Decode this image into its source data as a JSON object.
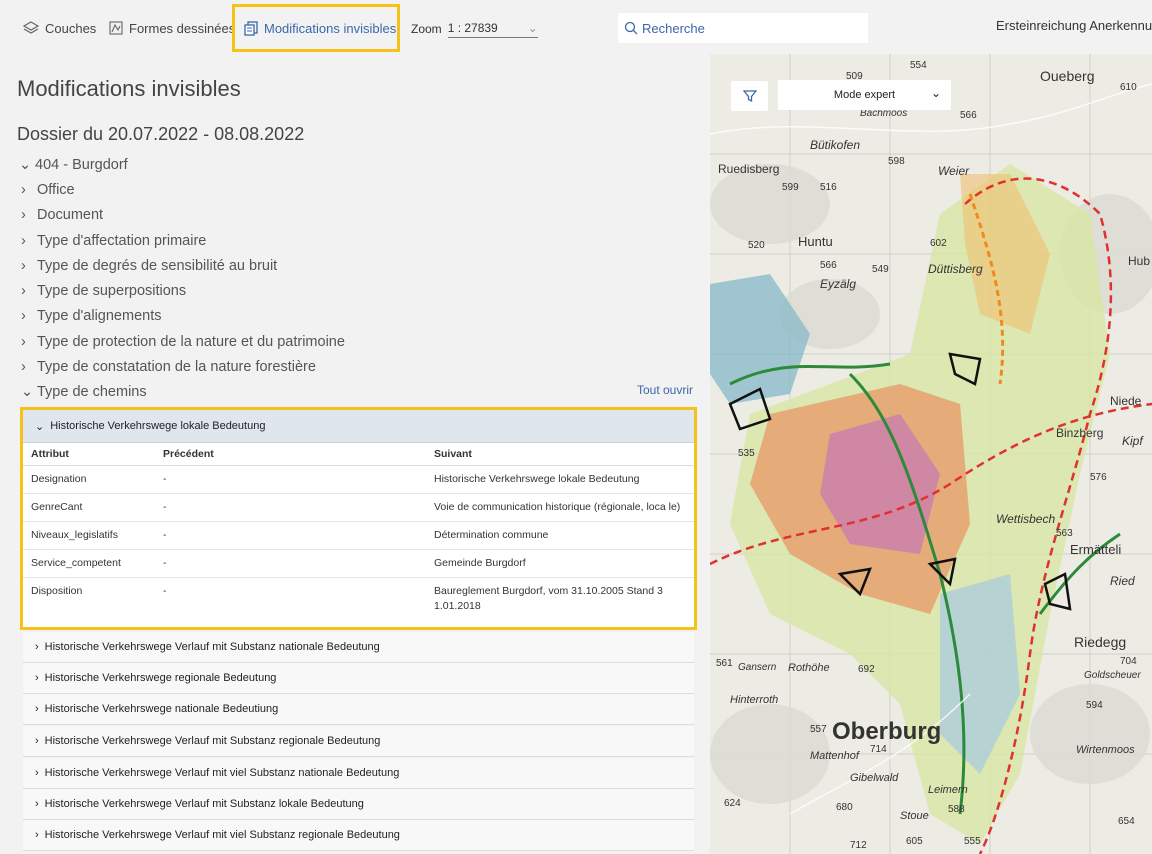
{
  "toolbar": {
    "layers_label": "Couches",
    "shapes_label": "Formes dessinées",
    "invisible_label": "Modifications invisibles",
    "zoom_label": "Zoom",
    "zoom_value": "1 : 27839",
    "search_placeholder": "Recherche",
    "right_text": "Ersteinreichung Anerkennung"
  },
  "panel": {
    "title": "Modifications invisibles",
    "dossier": "Dossier du 20.07.2022 - 08.08.2022",
    "tree": [
      {
        "label": "404 - Burgdorf",
        "chev": "⌄"
      },
      {
        "label": "Office",
        "chev": "›"
      },
      {
        "label": "Document",
        "chev": "›"
      },
      {
        "label": "Type d'affectation primaire",
        "chev": "›"
      },
      {
        "label": "Type de degrés de sensibilité au bruit",
        "chev": "›"
      },
      {
        "label": "Type de superpositions",
        "chev": "›"
      },
      {
        "label": "Type d'alignements",
        "chev": "›"
      },
      {
        "label": "Type de protection de la nature et du patrimoine",
        "chev": "›"
      },
      {
        "label": "Type de constatation de la nature forestière",
        "chev": "›"
      },
      {
        "label": "Type de chemins",
        "chev": "⌄"
      }
    ],
    "open_all": "Tout ouvrir",
    "expanded": {
      "title": "Historische Verkehrswege lokale Bedeutung",
      "headers": [
        "Attribut",
        "Précédent",
        "Suivant"
      ],
      "rows": [
        [
          "Designation",
          "-",
          "Historische Verkehrswege lokale Bedeutung"
        ],
        [
          "GenreCant",
          "-",
          "Voie de communication historique (régionale, loca le)"
        ],
        [
          "Niveaux_legislatifs",
          "-",
          "Détermination commune"
        ],
        [
          "Service_competent",
          "-",
          "Gemeinde Burgdorf"
        ],
        [
          "Disposition",
          "-",
          "Baureglement Burgdorf, vom 31.10.2005 Stand 3 1.01.2018"
        ]
      ]
    },
    "collapsed": [
      "Historische Verkehrswege Verlauf mit Substanz nationale Bedeutung",
      "Historische Verkehrswege regionale Bedeutung",
      "Historische Verkehrswege nationale Bedeutiung",
      "Historische Verkehrswege Verlauf mit Substanz regionale Bedeutung",
      "Historische Verkehrswege Verlauf mit viel Substanz nationale Bedeutung",
      "Historische Verkehrswege Verlauf mit Substanz lokale Bedeutung",
      "Historische Verkehrswege Verlauf mit viel Substanz regionale Bedeutung"
    ]
  },
  "map": {
    "mode_label": "Mode expert",
    "places": [
      "Oueberg",
      "Bütikofen",
      "Ruedisberg",
      "Huntu",
      "Düttisberg",
      "Eyzälg",
      "Weier",
      "Binzberg",
      "Hub",
      "Niede",
      "Kipf",
      "Wettisbech",
      "Ermätteli",
      "Ried",
      "Riedegg",
      "Goldscheuer",
      "Oberburg",
      "Gansern",
      "Rothöhe",
      "Hinterroth",
      "Mattenhof",
      "Gibelwald",
      "Leimern",
      "Stoue",
      "Wirtenmoos",
      "Bachmoos"
    ],
    "elevations": [
      "509",
      "554",
      "610",
      "566",
      "598",
      "599",
      "516",
      "520",
      "602",
      "566",
      "549",
      "535",
      "576",
      "563",
      "704",
      "594",
      "692",
      "557",
      "714",
      "624",
      "680",
      "588",
      "605",
      "555",
      "654",
      "712",
      "561"
    ]
  },
  "colors": {
    "accent": "#3a67a8",
    "highlight": "#f5c21a"
  }
}
